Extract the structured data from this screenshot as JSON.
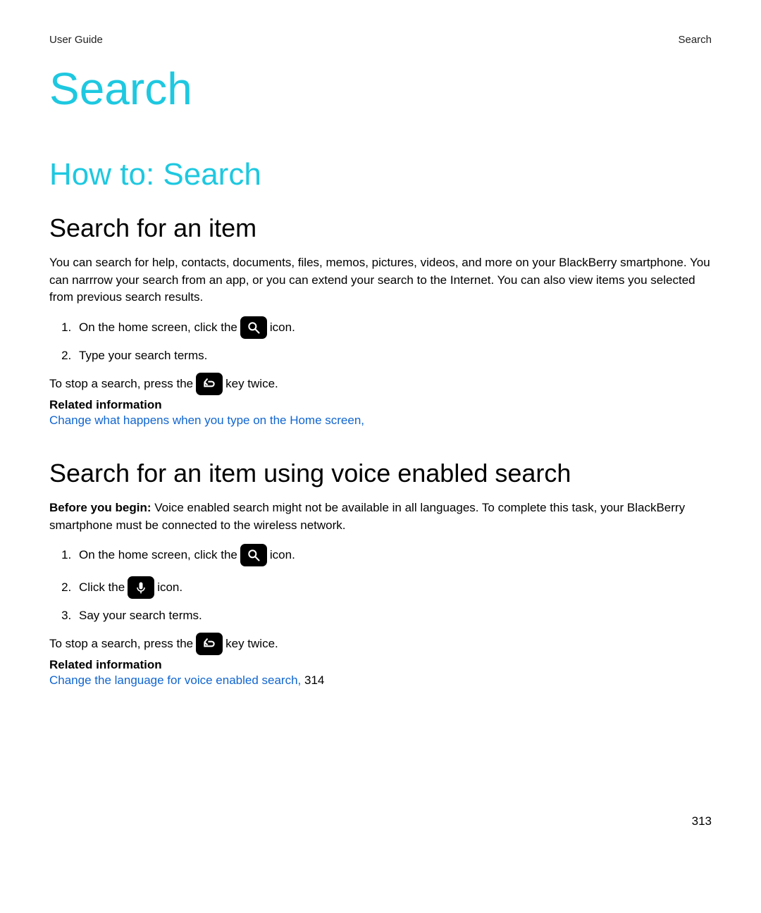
{
  "header": {
    "left": "User Guide",
    "right": "Search"
  },
  "title": "Search",
  "section_howto": "How to: Search",
  "sub1": {
    "heading": "Search for an item",
    "intro": "You can search for help, contacts, documents, files, memos, pictures, videos, and more on your BlackBerry smartphone. You can narrrow your search from an app, or you can extend your search to the Internet. You can also view items you selected from previous search results.",
    "step1_a": "On the home screen, click the",
    "step1_b": "icon.",
    "step2": "Type your search terms.",
    "stop_a": "To stop a search, press the",
    "stop_b": "key twice.",
    "related_label": "Related information",
    "related_link": "Change what happens when you type on the Home screen,"
  },
  "sub2": {
    "heading": "Search for an item using voice enabled search",
    "before_label": "Before you begin:",
    "before_text": " Voice enabled search might not be available in all languages. To complete this task, your BlackBerry smartphone must be connected to the wireless network.",
    "step1_a": "On the home screen, click the",
    "step1_b": "icon.",
    "step2_a": "Click the",
    "step2_b": "icon.",
    "step3": "Say your search terms.",
    "stop_a": "To stop a search, press the",
    "stop_b": "key twice.",
    "related_label": "Related information",
    "related_link": "Change the language for voice enabled search,",
    "related_page": " 314"
  },
  "page_number": "313"
}
